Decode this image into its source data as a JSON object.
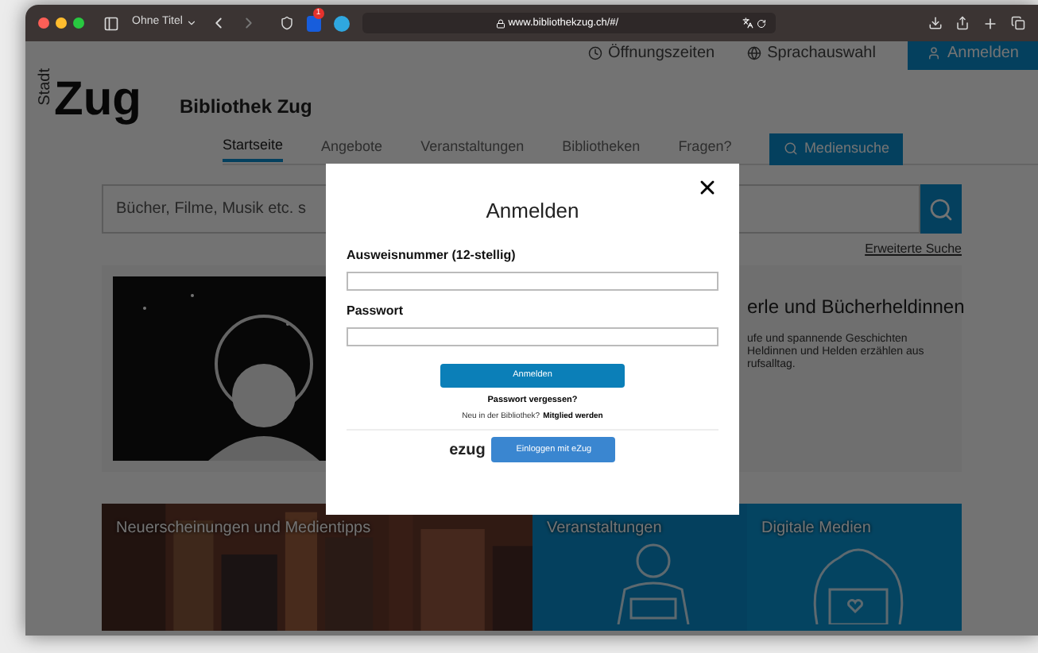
{
  "browser": {
    "tab_title": "Ohne Titel",
    "extension_badge": "1",
    "url": "www.bibliothekzug.ch/#/"
  },
  "page": {
    "top_links": [
      {
        "label": "Öffnungszeiten",
        "kind": "clock"
      },
      {
        "label": "Sprachauswahl",
        "kind": "globe"
      },
      {
        "label": "Anmelden",
        "kind": "button"
      }
    ],
    "logo": {
      "small": "Stadt",
      "big": "Zug"
    },
    "site_title": "Bibliothek Zug",
    "nav": [
      {
        "label": "Startseite",
        "selected": true
      },
      {
        "label": "Angebote",
        "selected": false
      },
      {
        "label": "Veranstaltungen",
        "selected": false
      },
      {
        "label": "Bibliotheken",
        "selected": false
      },
      {
        "label": "Fragen?",
        "selected": false
      }
    ],
    "media_search_button": "Mediensuche",
    "search": {
      "placeholder": "Bücher, Filme, Musik etc. s"
    },
    "advanced_search": "Erweiterte Suche",
    "feature": {
      "title": "erle und Bücherheldinnen",
      "text_lines": [
        "ufe und spannende Geschichten",
        "Heldinnen und Helden erzählen aus",
        "rufsalltag."
      ]
    },
    "tiles": [
      {
        "title": "Neuerscheinungen und Medientipps"
      },
      {
        "title": "Veranstaltungen",
        "kind": "event"
      },
      {
        "title": "Digitale Medien",
        "kind": "digital"
      }
    ]
  },
  "login_dialog": {
    "title": "Anmelden",
    "fields": [
      {
        "label": "Ausweisnummer (12-stellig)"
      },
      {
        "label": "Passwort"
      }
    ],
    "submit": "Anmelden",
    "forgot": "Passwort vergessen?",
    "signup_prompt": "Neu in der Bibliothek?",
    "signup_link": "Mitglied werden",
    "ezug_logo": "ezug",
    "ezug_button": "Einloggen mit eZug"
  }
}
